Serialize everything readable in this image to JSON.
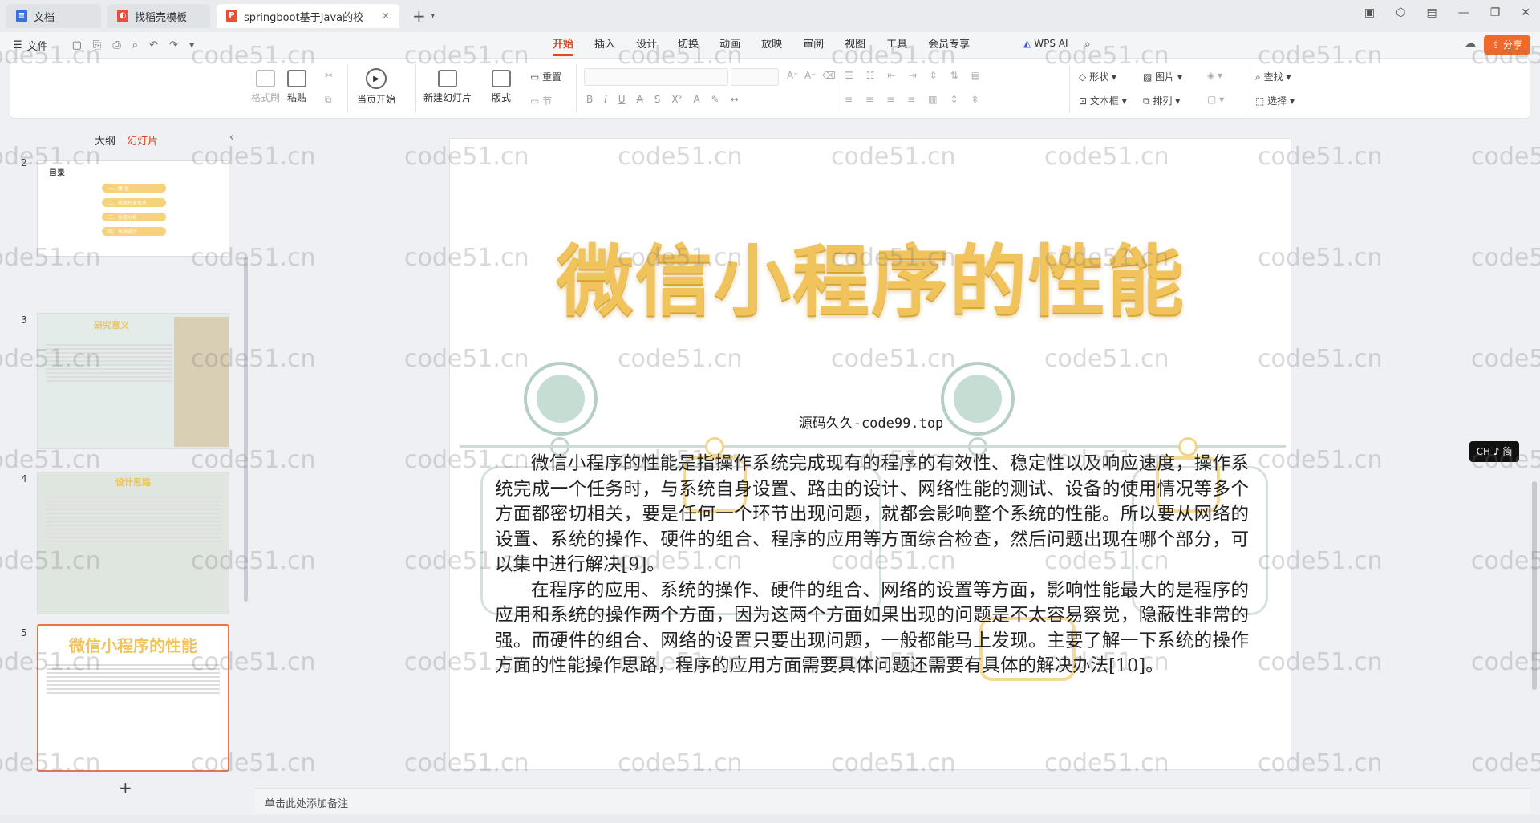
{
  "tabs": [
    {
      "label": "文档",
      "icon": "doc-icon",
      "color": "#3c6ee0"
    },
    {
      "label": "找稻壳模板",
      "icon": "template-icon",
      "color": "#e8503a"
    },
    {
      "label": "springboot基于Java的校园...",
      "icon": "ppt-icon",
      "color": "#e8503a"
    }
  ],
  "menu": {
    "file_label": "文件",
    "ribbon_tabs": [
      "开始",
      "插入",
      "设计",
      "切换",
      "动画",
      "放映",
      "审阅",
      "视图",
      "工具",
      "会员专享"
    ],
    "active_tab": "开始",
    "wps_ai": "WPS AI",
    "share": "分享"
  },
  "ribbon": {
    "format_painter": "格式刷",
    "paste": "粘贴",
    "play_current": "当页开始",
    "new_slide": "新建幻灯片",
    "layout": "版式",
    "reset": "重置",
    "section": "节",
    "shape": "形状",
    "picture": "图片",
    "find": "查找",
    "textbox": "文本框",
    "arrange": "排列",
    "select": "选择"
  },
  "panel": {
    "tab_outline": "大纲",
    "tab_slides": "幻灯片",
    "slides": [
      {
        "num": "2",
        "title": "目录",
        "items": [
          "一、绪 论",
          "二、系统开发技术",
          "三、系统分析",
          "四、系统设计"
        ]
      },
      {
        "num": "3",
        "title": "研究意义"
      },
      {
        "num": "4",
        "title": "设计思路"
      },
      {
        "num": "5",
        "title": "微信小程序的性能"
      }
    ]
  },
  "slide": {
    "title": "微信小程序的性能",
    "source": "源码久久-code99.top",
    "paragraphs": [
      "微信小程序的性能是指操作系统完成现有的程序的有效性、稳定性以及响应速度，操作系统完成一个任务时，与系统自身设置、路由的设计、网络性能的测试、设备的使用情况等多个方面都密切相关，要是任何一个环节出现问题，就都会影响整个系统的性能。所以要从网络的设置、系统的操作、硬件的组合、程序的应用等方面综合检查，然后问题出现在哪个部分，可以集中进行解决[9]。",
      "在程序的应用、系统的操作、硬件的组合、网络的设置等方面，影响性能最大的是程序的应用和系统的操作两个方面，因为这两个方面如果出现的问题是不太容易察觉，隐蔽性非常的强。而硬件的组合、网络的设置只要出现问题，一般都能马上发现。主要了解一下系统的操作方面的性能操作思路，程序的应用方面需要具体问题还需要有具体的解决办法[10]。"
    ]
  },
  "notes_placeholder": "单击此处添加备注",
  "ime": "CH ♪ 简",
  "watermark": "code51.cn"
}
